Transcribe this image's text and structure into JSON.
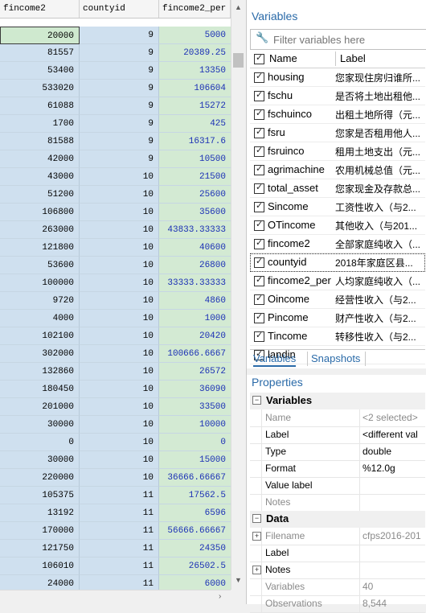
{
  "grid": {
    "columns": [
      "fincome2",
      "countyid",
      "fincome2_per"
    ],
    "rows": [
      {
        "fincome2": "20000",
        "countyid": "9",
        "fincome2_per": "5000"
      },
      {
        "fincome2": "81557",
        "countyid": "9",
        "fincome2_per": "20389.25"
      },
      {
        "fincome2": "53400",
        "countyid": "9",
        "fincome2_per": "13350"
      },
      {
        "fincome2": "533020",
        "countyid": "9",
        "fincome2_per": "106604"
      },
      {
        "fincome2": "61088",
        "countyid": "9",
        "fincome2_per": "15272"
      },
      {
        "fincome2": "1700",
        "countyid": "9",
        "fincome2_per": "425"
      },
      {
        "fincome2": "81588",
        "countyid": "9",
        "fincome2_per": "16317.6"
      },
      {
        "fincome2": "42000",
        "countyid": "9",
        "fincome2_per": "10500"
      },
      {
        "fincome2": "43000",
        "countyid": "10",
        "fincome2_per": "21500"
      },
      {
        "fincome2": "51200",
        "countyid": "10",
        "fincome2_per": "25600"
      },
      {
        "fincome2": "106800",
        "countyid": "10",
        "fincome2_per": "35600"
      },
      {
        "fincome2": "263000",
        "countyid": "10",
        "fincome2_per": "43833.33333"
      },
      {
        "fincome2": "121800",
        "countyid": "10",
        "fincome2_per": "40600"
      },
      {
        "fincome2": "53600",
        "countyid": "10",
        "fincome2_per": "26800"
      },
      {
        "fincome2": "100000",
        "countyid": "10",
        "fincome2_per": "33333.33333"
      },
      {
        "fincome2": "9720",
        "countyid": "10",
        "fincome2_per": "4860"
      },
      {
        "fincome2": "4000",
        "countyid": "10",
        "fincome2_per": "1000"
      },
      {
        "fincome2": "102100",
        "countyid": "10",
        "fincome2_per": "20420"
      },
      {
        "fincome2": "302000",
        "countyid": "10",
        "fincome2_per": "100666.6667"
      },
      {
        "fincome2": "132860",
        "countyid": "10",
        "fincome2_per": "26572"
      },
      {
        "fincome2": "180450",
        "countyid": "10",
        "fincome2_per": "36090"
      },
      {
        "fincome2": "201000",
        "countyid": "10",
        "fincome2_per": "33500"
      },
      {
        "fincome2": "30000",
        "countyid": "10",
        "fincome2_per": "10000"
      },
      {
        "fincome2": "0",
        "countyid": "10",
        "fincome2_per": "0"
      },
      {
        "fincome2": "30000",
        "countyid": "10",
        "fincome2_per": "15000"
      },
      {
        "fincome2": "220000",
        "countyid": "10",
        "fincome2_per": "36666.66667"
      },
      {
        "fincome2": "105375",
        "countyid": "11",
        "fincome2_per": "17562.5"
      },
      {
        "fincome2": "13192",
        "countyid": "11",
        "fincome2_per": "6596"
      },
      {
        "fincome2": "170000",
        "countyid": "11",
        "fincome2_per": "56666.66667"
      },
      {
        "fincome2": "121750",
        "countyid": "11",
        "fincome2_per": "24350"
      },
      {
        "fincome2": "106010",
        "countyid": "11",
        "fincome2_per": "26502.5"
      },
      {
        "fincome2": "24000",
        "countyid": "11",
        "fincome2_per": "6000"
      }
    ]
  },
  "variables_panel": {
    "title": "Variables",
    "filter_placeholder": "Filter variables here",
    "col_name": "Name",
    "col_label": "Label",
    "items": [
      {
        "name": "housing",
        "label": "您家现住房归谁所..."
      },
      {
        "name": "fschu",
        "label": "是否将土地出租他..."
      },
      {
        "name": "fschuinco",
        "label": "出租土地所得（元..."
      },
      {
        "name": "fsru",
        "label": "您家是否租用他人..."
      },
      {
        "name": "fsruinco",
        "label": "租用土地支出（元..."
      },
      {
        "name": "agrimachine",
        "label": "农用机械总值（元..."
      },
      {
        "name": "total_asset",
        "label": "您家现金及存款总..."
      },
      {
        "name": "Sincome",
        "label": "工资性收入（与2..."
      },
      {
        "name": "OTincome",
        "label": "其他收入（与201..."
      },
      {
        "name": "fincome2",
        "label": "全部家庭纯收入（..."
      },
      {
        "name": "countyid",
        "label": "2018年家庭区县..."
      },
      {
        "name": "fincome2_per",
        "label": "人均家庭纯收入（..."
      },
      {
        "name": "Oincome",
        "label": "经营性收入（与2..."
      },
      {
        "name": "Pincome",
        "label": "财产性收入（与2..."
      },
      {
        "name": "Tincome",
        "label": "转移性收入（与2..."
      },
      {
        "name": "landin",
        "label": ""
      }
    ],
    "tabs": [
      "Variables",
      "Snapshots"
    ]
  },
  "properties_panel": {
    "title": "Properties",
    "section_variables": "Variables",
    "var_props": [
      {
        "key": "Name",
        "value": "<2 selected>",
        "dim": true
      },
      {
        "key": "Label",
        "value": "<different val",
        "dim": false
      },
      {
        "key": "Type",
        "value": "double",
        "dim": false
      },
      {
        "key": "Format",
        "value": "%12.0g",
        "dim": false
      },
      {
        "key": "Value label",
        "value": "",
        "dim": false
      },
      {
        "key": "Notes",
        "value": "",
        "dim": true
      }
    ],
    "section_data": "Data",
    "data_props": [
      {
        "key": "Filename",
        "value": "cfps2016-201",
        "dim": true,
        "expand": true
      },
      {
        "key": "Label",
        "value": "",
        "dim": false,
        "expand": false
      },
      {
        "key": "Notes",
        "value": "",
        "dim": false,
        "expand": true
      },
      {
        "key": "Variables",
        "value": "40",
        "dim": true,
        "expand": false
      },
      {
        "key": "Observations",
        "value": "8,544",
        "dim": true,
        "expand": false
      }
    ]
  }
}
